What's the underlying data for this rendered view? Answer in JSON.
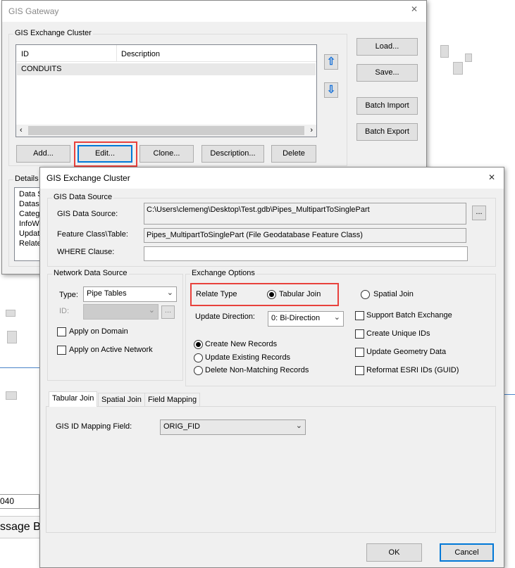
{
  "gateway": {
    "title": "GIS Gateway",
    "group": "GIS Exchange Cluster",
    "columns": [
      "ID",
      "Description"
    ],
    "rows": [
      {
        "id": "CONDUITS",
        "description": ""
      }
    ],
    "buttons": {
      "load": "Load...",
      "save": "Save...",
      "batch_import": "Batch Import",
      "batch_export": "Batch Export",
      "add": "Add...",
      "edit": "Edit...",
      "clone": "Clone...",
      "description": "Description...",
      "delete": "Delete"
    },
    "details": {
      "label": "Details",
      "items": [
        "Data S",
        "Datase",
        "Catego",
        "InfoWa",
        "Update",
        "Relate"
      ]
    }
  },
  "background": {
    "field_value": "040",
    "panel_label": "ssage Bo"
  },
  "cluster": {
    "title": "GIS Exchange Cluster",
    "gis_source": {
      "group": "GIS Data Source",
      "source_label": "GIS Data Source:",
      "source_value": "C:\\Users\\clemeng\\Desktop\\Test.gdb\\Pipes_MultipartToSinglePart",
      "browse": "...",
      "fc_label": "Feature Class\\Table:",
      "fc_value": "Pipes_MultipartToSinglePart (File Geodatabase Feature Class)",
      "where_label": "WHERE Clause:",
      "where_value": ""
    },
    "network": {
      "group": "Network Data Source",
      "type_label": "Type:",
      "type_value": "Pipe Tables",
      "id_label": "ID:",
      "id_value": "",
      "browse": "...",
      "apply_domain": "Apply on Domain",
      "apply_active": "Apply on Active Network"
    },
    "exchange": {
      "group": "Exchange Options",
      "relate_label": "Relate Type",
      "tabular": "Tabular Join",
      "spatial": "Spatial Join",
      "direction_label": "Update Direction:",
      "direction_value": "0: Bi-Direction",
      "records": [
        "Create New Records",
        "Update Existing Records",
        "Delete Non-Matching Records"
      ],
      "checks": [
        "Support Batch Exchange",
        "Create Unique IDs",
        "Update Geometry Data",
        "Reformat ESRI IDs (GUID)"
      ]
    },
    "tabs": [
      "Tabular Join",
      "Spatial Join",
      "Field Mapping"
    ],
    "mapping": {
      "label": "GIS ID Mapping Field:",
      "value": "ORIG_FID"
    },
    "ok": "OK",
    "cancel": "Cancel"
  }
}
